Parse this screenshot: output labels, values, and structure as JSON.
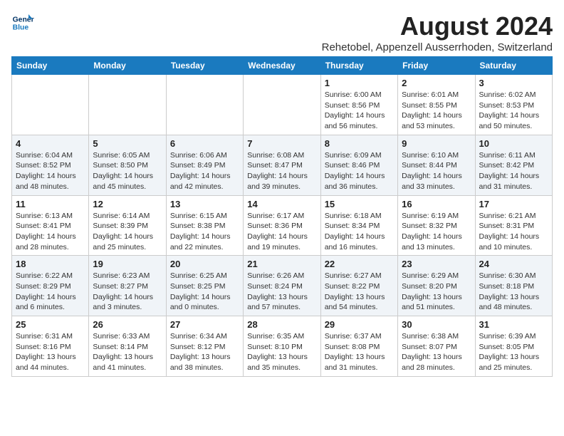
{
  "logo": {
    "line1": "General",
    "line2": "Blue"
  },
  "title": "August 2024",
  "subtitle": "Rehetobel, Appenzell Ausserrhoden, Switzerland",
  "days_of_week": [
    "Sunday",
    "Monday",
    "Tuesday",
    "Wednesday",
    "Thursday",
    "Friday",
    "Saturday"
  ],
  "weeks": [
    [
      {
        "day": "",
        "info": ""
      },
      {
        "day": "",
        "info": ""
      },
      {
        "day": "",
        "info": ""
      },
      {
        "day": "",
        "info": ""
      },
      {
        "day": "1",
        "info": "Sunrise: 6:00 AM\nSunset: 8:56 PM\nDaylight: 14 hours\nand 56 minutes."
      },
      {
        "day": "2",
        "info": "Sunrise: 6:01 AM\nSunset: 8:55 PM\nDaylight: 14 hours\nand 53 minutes."
      },
      {
        "day": "3",
        "info": "Sunrise: 6:02 AM\nSunset: 8:53 PM\nDaylight: 14 hours\nand 50 minutes."
      }
    ],
    [
      {
        "day": "4",
        "info": "Sunrise: 6:04 AM\nSunset: 8:52 PM\nDaylight: 14 hours\nand 48 minutes."
      },
      {
        "day": "5",
        "info": "Sunrise: 6:05 AM\nSunset: 8:50 PM\nDaylight: 14 hours\nand 45 minutes."
      },
      {
        "day": "6",
        "info": "Sunrise: 6:06 AM\nSunset: 8:49 PM\nDaylight: 14 hours\nand 42 minutes."
      },
      {
        "day": "7",
        "info": "Sunrise: 6:08 AM\nSunset: 8:47 PM\nDaylight: 14 hours\nand 39 minutes."
      },
      {
        "day": "8",
        "info": "Sunrise: 6:09 AM\nSunset: 8:46 PM\nDaylight: 14 hours\nand 36 minutes."
      },
      {
        "day": "9",
        "info": "Sunrise: 6:10 AM\nSunset: 8:44 PM\nDaylight: 14 hours\nand 33 minutes."
      },
      {
        "day": "10",
        "info": "Sunrise: 6:11 AM\nSunset: 8:42 PM\nDaylight: 14 hours\nand 31 minutes."
      }
    ],
    [
      {
        "day": "11",
        "info": "Sunrise: 6:13 AM\nSunset: 8:41 PM\nDaylight: 14 hours\nand 28 minutes."
      },
      {
        "day": "12",
        "info": "Sunrise: 6:14 AM\nSunset: 8:39 PM\nDaylight: 14 hours\nand 25 minutes."
      },
      {
        "day": "13",
        "info": "Sunrise: 6:15 AM\nSunset: 8:38 PM\nDaylight: 14 hours\nand 22 minutes."
      },
      {
        "day": "14",
        "info": "Sunrise: 6:17 AM\nSunset: 8:36 PM\nDaylight: 14 hours\nand 19 minutes."
      },
      {
        "day": "15",
        "info": "Sunrise: 6:18 AM\nSunset: 8:34 PM\nDaylight: 14 hours\nand 16 minutes."
      },
      {
        "day": "16",
        "info": "Sunrise: 6:19 AM\nSunset: 8:32 PM\nDaylight: 14 hours\nand 13 minutes."
      },
      {
        "day": "17",
        "info": "Sunrise: 6:21 AM\nSunset: 8:31 PM\nDaylight: 14 hours\nand 10 minutes."
      }
    ],
    [
      {
        "day": "18",
        "info": "Sunrise: 6:22 AM\nSunset: 8:29 PM\nDaylight: 14 hours\nand 6 minutes."
      },
      {
        "day": "19",
        "info": "Sunrise: 6:23 AM\nSunset: 8:27 PM\nDaylight: 14 hours\nand 3 minutes."
      },
      {
        "day": "20",
        "info": "Sunrise: 6:25 AM\nSunset: 8:25 PM\nDaylight: 14 hours\nand 0 minutes."
      },
      {
        "day": "21",
        "info": "Sunrise: 6:26 AM\nSunset: 8:24 PM\nDaylight: 13 hours\nand 57 minutes."
      },
      {
        "day": "22",
        "info": "Sunrise: 6:27 AM\nSunset: 8:22 PM\nDaylight: 13 hours\nand 54 minutes."
      },
      {
        "day": "23",
        "info": "Sunrise: 6:29 AM\nSunset: 8:20 PM\nDaylight: 13 hours\nand 51 minutes."
      },
      {
        "day": "24",
        "info": "Sunrise: 6:30 AM\nSunset: 8:18 PM\nDaylight: 13 hours\nand 48 minutes."
      }
    ],
    [
      {
        "day": "25",
        "info": "Sunrise: 6:31 AM\nSunset: 8:16 PM\nDaylight: 13 hours\nand 44 minutes."
      },
      {
        "day": "26",
        "info": "Sunrise: 6:33 AM\nSunset: 8:14 PM\nDaylight: 13 hours\nand 41 minutes."
      },
      {
        "day": "27",
        "info": "Sunrise: 6:34 AM\nSunset: 8:12 PM\nDaylight: 13 hours\nand 38 minutes."
      },
      {
        "day": "28",
        "info": "Sunrise: 6:35 AM\nSunset: 8:10 PM\nDaylight: 13 hours\nand 35 minutes."
      },
      {
        "day": "29",
        "info": "Sunrise: 6:37 AM\nSunset: 8:08 PM\nDaylight: 13 hours\nand 31 minutes."
      },
      {
        "day": "30",
        "info": "Sunrise: 6:38 AM\nSunset: 8:07 PM\nDaylight: 13 hours\nand 28 minutes."
      },
      {
        "day": "31",
        "info": "Sunrise: 6:39 AM\nSunset: 8:05 PM\nDaylight: 13 hours\nand 25 minutes."
      }
    ]
  ]
}
